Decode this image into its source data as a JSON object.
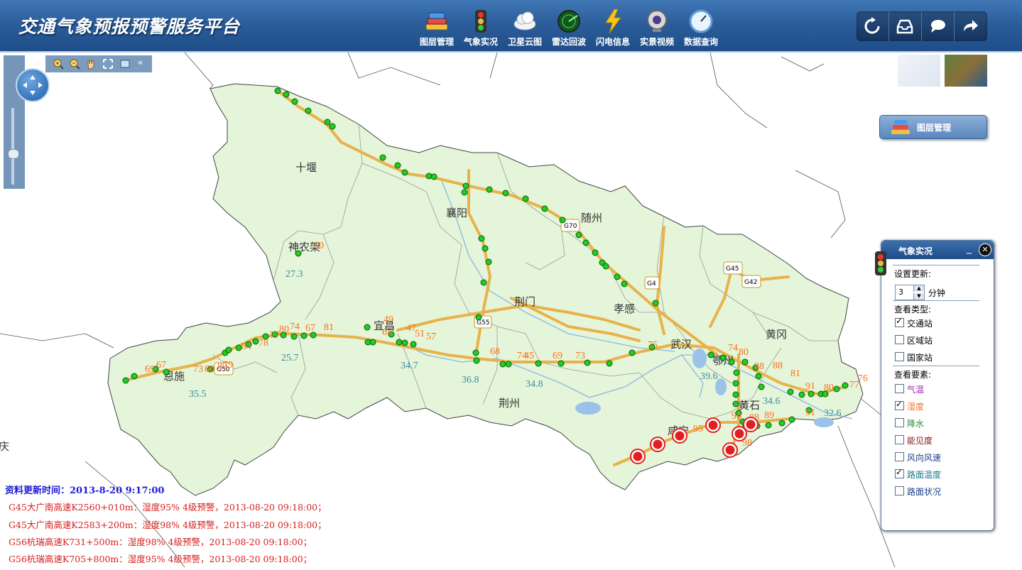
{
  "header": {
    "title": "交通气象预报预警服务平台",
    "tools": [
      {
        "label": "图层管理",
        "icon": "layers-icon"
      },
      {
        "label": "气象实况",
        "icon": "traffic-light-icon"
      },
      {
        "label": "卫星云图",
        "icon": "cloud-icon"
      },
      {
        "label": "雷达回波",
        "icon": "radar-icon"
      },
      {
        "label": "闪电信息",
        "icon": "lightning-icon"
      },
      {
        "label": "实景视频",
        "icon": "webcam-icon"
      },
      {
        "label": "数据查询",
        "icon": "clock-gauge-icon"
      }
    ],
    "right_buttons": [
      "refresh-icon",
      "inbox-icon",
      "chat-icon",
      "share-arrow-icon"
    ]
  },
  "map": {
    "cities": [
      "十堰",
      "襄阳",
      "随州",
      "神农架",
      "荆门",
      "孝感",
      "宜昌",
      "武汉",
      "黄冈",
      "恩施",
      "荆州",
      "黄石",
      "咸宁",
      "鄂州"
    ],
    "shields": [
      "G70",
      "G4",
      "G55",
      "G50",
      "G45",
      "G42"
    ],
    "edge_label": "庆",
    "orange_values": [
      "69",
      "67",
      "73",
      "60",
      "80",
      "79",
      "84",
      "78",
      "77",
      "80",
      "74",
      "67",
      "81",
      "49",
      "65",
      "47",
      "51",
      "57",
      "68",
      "74",
      "45",
      "69",
      "73",
      "75",
      "74",
      "80",
      "88",
      "81",
      "88",
      "91",
      "80",
      "77",
      "76",
      "91",
      "95",
      "89",
      "88",
      "98",
      "90",
      "50"
    ],
    "teal_values": [
      "27.3",
      "25.7",
      "34.7",
      "35.5",
      "36.8",
      "34.8",
      "39.6",
      "34.6",
      "32.6"
    ]
  },
  "layer_manager": {
    "label": "图层管理"
  },
  "weather_panel": {
    "title": "气象实况",
    "update_label": "设置更新:",
    "interval_value": "3",
    "interval_unit": "分钟",
    "type_label": "查看类型:",
    "types": [
      {
        "label": "交通站",
        "checked": true
      },
      {
        "label": "区域站",
        "checked": false
      },
      {
        "label": "国家站",
        "checked": false
      }
    ],
    "element_label": "查看要素:",
    "elements": [
      {
        "label": "气温",
        "checked": false,
        "color": "#9c27b0"
      },
      {
        "label": "湿度",
        "checked": true,
        "color": "#ff6d1a"
      },
      {
        "label": "降水",
        "checked": false,
        "color": "#2e8b3a"
      },
      {
        "label": "能见度",
        "checked": false,
        "color": "#8b1a1a"
      },
      {
        "label": "风向风速",
        "checked": false,
        "color": "#1a3f8b"
      },
      {
        "label": "路面温度",
        "checked": true,
        "color": "#1b7a8b"
      },
      {
        "label": "路面状况",
        "checked": false,
        "color": "#1a3f8b"
      }
    ]
  },
  "footer": {
    "update_time_label": "资料更新时间：2013-8-20 9:17:00",
    "warnings": [
      "G45大广南高速K2560+010m：湿度95%  4级预警，2013-08-20 09:18:00；",
      "G45大广南高速K2583+200m：湿度98%  4级预警，2013-08-20 09:18:00；",
      "G56杭瑞高速K731+500m：湿度98%  4级预警，2013-08-20 09:18:00；",
      "G56杭瑞高速K705+800m：湿度95%  4级预警，2013-08-20 09:18:00；"
    ]
  },
  "colors": {
    "header_blue": "#2c5e9b",
    "province_fill": "#e4f5d9",
    "road": "#e8b24a",
    "station_green": "#22cc22",
    "warning_red": "#e02020",
    "humidity_orange": "#ff6d1a",
    "road_temp_teal": "#3c8a9c"
  }
}
